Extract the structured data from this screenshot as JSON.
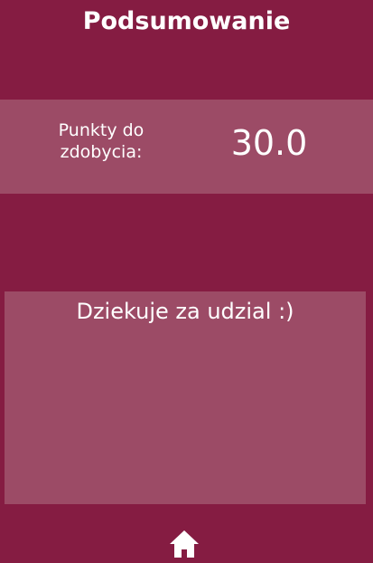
{
  "header": {
    "title": "Podsumowanie"
  },
  "score": {
    "label": "Punkty do zdobycia:",
    "value": "30.0"
  },
  "message": {
    "text": "Dziekuje za udzial :)"
  },
  "footer": {
    "home_icon": "home-icon"
  },
  "colors": {
    "background": "#851c42",
    "panel": "#9c4b66",
    "text": "#ffffff"
  }
}
